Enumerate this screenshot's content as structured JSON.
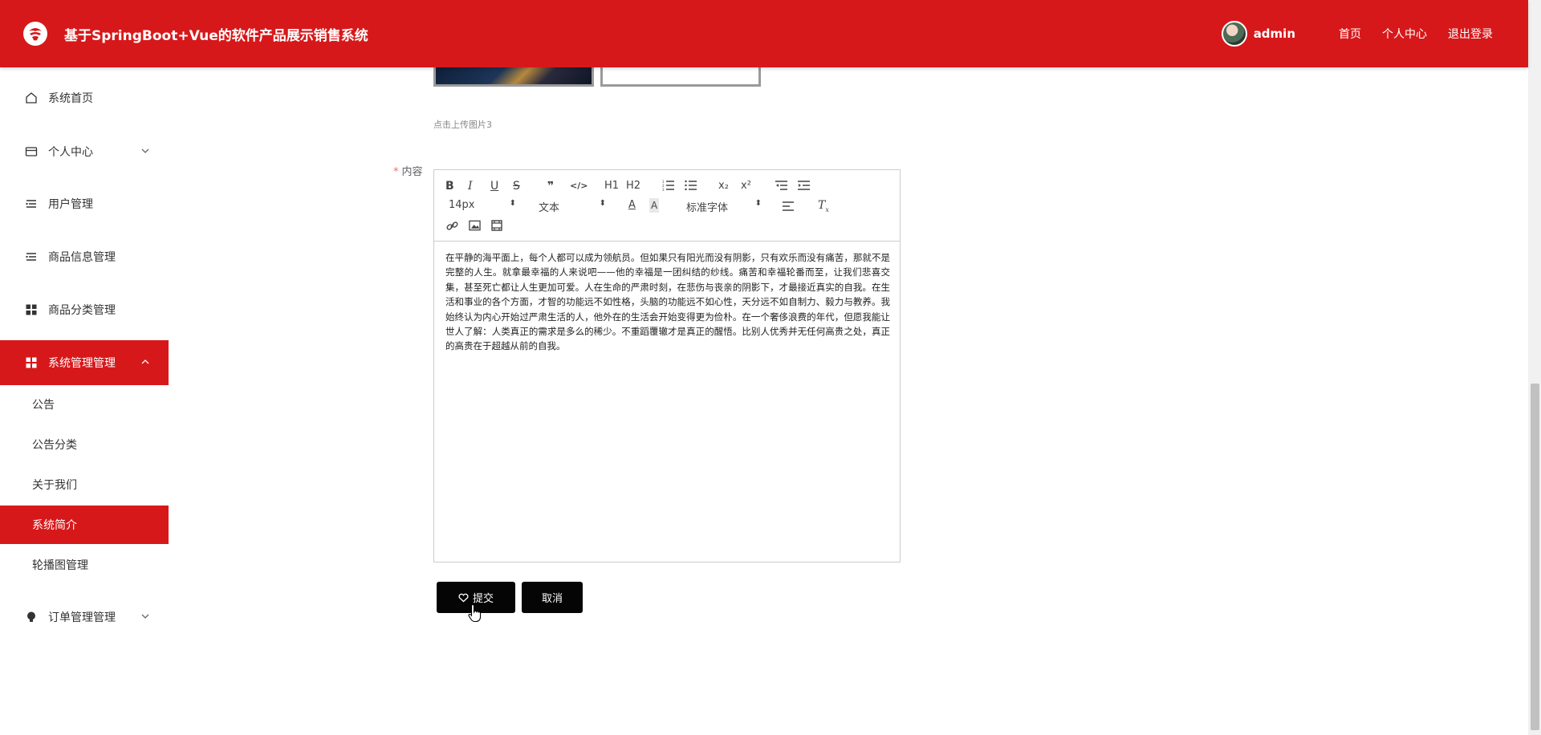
{
  "header": {
    "app_title": "基于SpringBoot+Vue的软件产品展示销售系统",
    "username": "admin",
    "links": [
      "首页",
      "个人中心",
      "退出登录"
    ],
    "brand_color": "#d7181a"
  },
  "sidebar": {
    "items": [
      {
        "label": "系统首页",
        "icon": "home-icon"
      },
      {
        "label": "个人中心",
        "icon": "card-icon",
        "expandable": true
      },
      {
        "label": "用户管理",
        "icon": "list-icon"
      },
      {
        "label": "商品信息管理",
        "icon": "list-icon"
      },
      {
        "label": "商品分类管理",
        "icon": "grid-icon"
      },
      {
        "label": "系统管理管理",
        "icon": "grid-icon",
        "expandable": true,
        "expanded": true,
        "active": true
      },
      {
        "label": "订单管理管理",
        "icon": "bulb-icon",
        "expandable": true
      }
    ],
    "sub_items": [
      "公告",
      "公告分类",
      "关于我们",
      "系统简介",
      "轮播图管理"
    ],
    "active_sub": "系统简介"
  },
  "form": {
    "upload_hint": "点击上传图片3",
    "content_label": "内容",
    "required_mark": "*"
  },
  "editor": {
    "toolbar": {
      "row1": [
        "B",
        "I",
        "U",
        "S",
        "❞",
        "</>",
        "H1",
        "H2",
        "ol",
        "ul",
        "x₂",
        "x²",
        "outdent",
        "indent"
      ],
      "font_size": "14px",
      "block_format": "文本",
      "font_family": "标准字体"
    },
    "content": "在平静的海平面上，每个人都可以成为领航员。但如果只有阳光而没有阴影，只有欢乐而没有痛苦，那就不是完整的人生。就拿最幸福的人来说吧——他的幸福是一团纠结的纱线。痛苦和幸福轮番而至，让我们悲喜交集，甚至死亡都让人生更加可爱。人在生命的严肃时刻，在悲伤与丧亲的阴影下，才最接近真实的自我。在生活和事业的各个方面，才智的功能远不如性格，头脑的功能远不如心性，天分远不如自制力、毅力与教养。我始终认为内心开始过严肃生活的人，他外在的生活会开始变得更为俭朴。在一个奢侈浪费的年代，但愿我能让世人了解：人类真正的需求是多么的稀少。不重蹈覆辙才是真正的醒悟。比别人优秀并无任何高贵之处，真正的高贵在于超越从前的自我。"
  },
  "buttons": {
    "submit": "提交",
    "cancel": "取消"
  }
}
